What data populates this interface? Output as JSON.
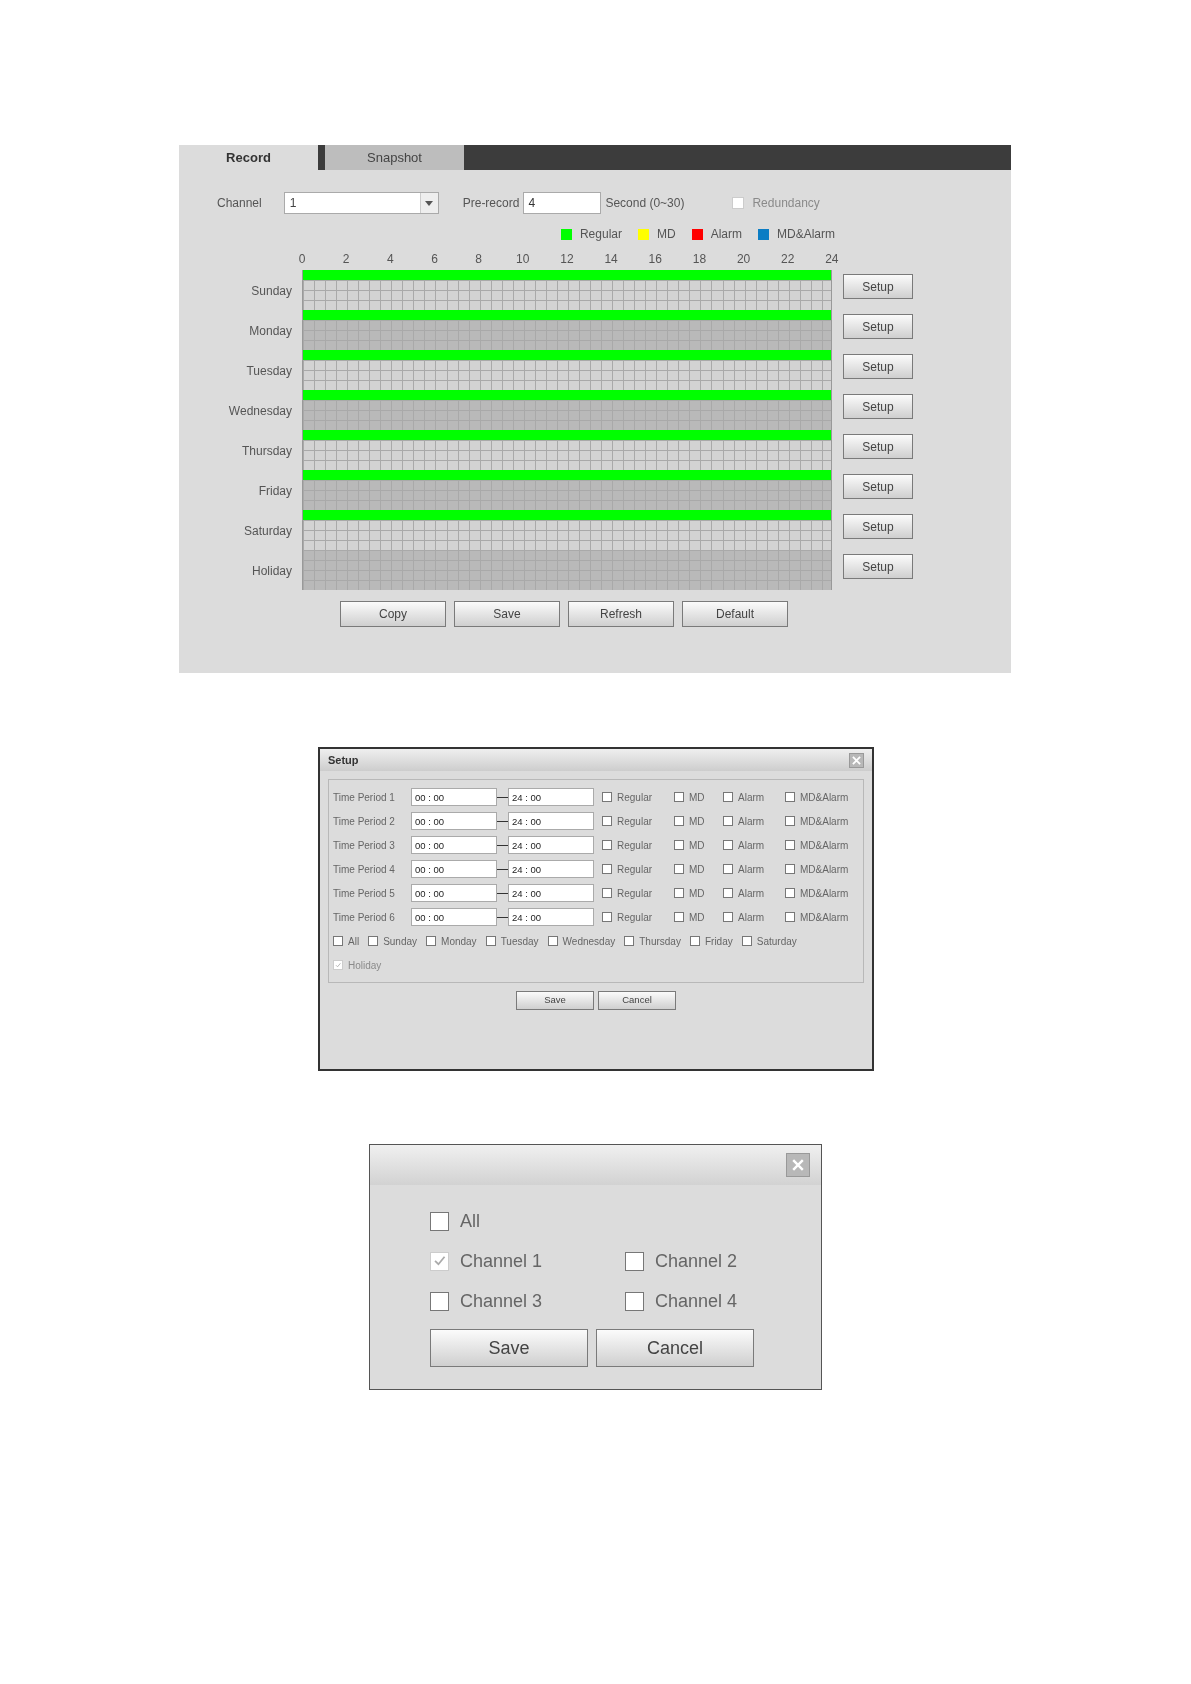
{
  "record_panel": {
    "tabs": [
      {
        "label": "Record",
        "selected": true
      },
      {
        "label": "Snapshot",
        "selected": false
      }
    ],
    "channel": {
      "label": "Channel",
      "value": "1"
    },
    "pre_record": {
      "label": "Pre-record",
      "value": "4",
      "unit": "Second (0~30)"
    },
    "redundancy": {
      "label": "Redundancy",
      "checked": false,
      "disabled": true
    },
    "legend": [
      {
        "label": "Regular",
        "color": "#00ff00"
      },
      {
        "label": "MD",
        "color": "#ffff00"
      },
      {
        "label": "Alarm",
        "color": "#ff0000"
      },
      {
        "label": "MD&Alarm",
        "color": "#0b7dc4"
      }
    ],
    "hours": [
      "0",
      "2",
      "4",
      "6",
      "8",
      "10",
      "12",
      "14",
      "16",
      "18",
      "20",
      "22",
      "24"
    ],
    "days": [
      {
        "name": "Sunday",
        "color": "#00ff00",
        "level": 1,
        "setup": "Setup"
      },
      {
        "name": "Monday",
        "color": "#00ff00",
        "level": 1,
        "setup": "Setup"
      },
      {
        "name": "Tuesday",
        "color": "#00ff00",
        "level": 1,
        "setup": "Setup"
      },
      {
        "name": "Wednesday",
        "color": "#00ff00",
        "level": 1,
        "setup": "Setup"
      },
      {
        "name": "Thursday",
        "color": "#00ff00",
        "level": 1,
        "setup": "Setup"
      },
      {
        "name": "Friday",
        "color": "#00ff00",
        "level": 1,
        "setup": "Setup"
      },
      {
        "name": "Saturday",
        "color": "#00ff00",
        "level": 1,
        "setup": "Setup"
      },
      {
        "name": "Holiday",
        "setup": "Setup"
      }
    ],
    "buttons": [
      "Copy",
      "Save",
      "Refresh",
      "Default"
    ]
  },
  "setup_dialog": {
    "title": "Setup",
    "periods": [
      {
        "label": "Time Period 1",
        "start": "00 : 00",
        "end": "24 : 00",
        "types": [
          {
            "label": "Regular",
            "checked": false
          },
          {
            "label": "MD",
            "checked": false
          },
          {
            "label": "Alarm",
            "checked": false
          },
          {
            "label": "MD&Alarm",
            "checked": false
          }
        ]
      },
      {
        "label": "Time Period 2",
        "start": "00 : 00",
        "end": "24 : 00",
        "types": [
          {
            "label": "Regular",
            "checked": false
          },
          {
            "label": "MD",
            "checked": false
          },
          {
            "label": "Alarm",
            "checked": false
          },
          {
            "label": "MD&Alarm",
            "checked": false
          }
        ]
      },
      {
        "label": "Time Period 3",
        "start": "00 : 00",
        "end": "24 : 00",
        "types": [
          {
            "label": "Regular",
            "checked": false
          },
          {
            "label": "MD",
            "checked": false
          },
          {
            "label": "Alarm",
            "checked": false
          },
          {
            "label": "MD&Alarm",
            "checked": false
          }
        ]
      },
      {
        "label": "Time Period 4",
        "start": "00 : 00",
        "end": "24 : 00",
        "types": [
          {
            "label": "Regular",
            "checked": false
          },
          {
            "label": "MD",
            "checked": false
          },
          {
            "label": "Alarm",
            "checked": false
          },
          {
            "label": "MD&Alarm",
            "checked": false
          }
        ]
      },
      {
        "label": "Time Period 5",
        "start": "00 : 00",
        "end": "24 : 00",
        "types": [
          {
            "label": "Regular",
            "checked": false
          },
          {
            "label": "MD",
            "checked": false
          },
          {
            "label": "Alarm",
            "checked": false
          },
          {
            "label": "MD&Alarm",
            "checked": false
          }
        ]
      },
      {
        "label": "Time Period 6",
        "start": "00 : 00",
        "end": "24 : 00",
        "types": [
          {
            "label": "Regular",
            "checked": false
          },
          {
            "label": "MD",
            "checked": false
          },
          {
            "label": "Alarm",
            "checked": false
          },
          {
            "label": "MD&Alarm",
            "checked": false
          }
        ]
      }
    ],
    "day_rows": [
      [
        {
          "label": "All",
          "checked": false,
          "disabled": false
        },
        {
          "label": "Sunday",
          "checked": false,
          "disabled": false
        },
        {
          "label": "Monday",
          "checked": false,
          "disabled": false
        },
        {
          "label": "Tuesday",
          "checked": false,
          "disabled": false
        },
        {
          "label": "Wednesday",
          "checked": false,
          "disabled": false
        },
        {
          "label": "Thursday",
          "checked": false,
          "disabled": false
        },
        {
          "label": "Friday",
          "checked": false,
          "disabled": false
        },
        {
          "label": "Saturday",
          "checked": false,
          "disabled": false
        }
      ],
      [
        {
          "label": "Holiday",
          "checked": true,
          "disabled": true
        }
      ]
    ],
    "buttons": [
      "Save",
      "Cancel"
    ]
  },
  "channel_dialog": {
    "option_rows": [
      [
        {
          "label": "All",
          "checked": false,
          "disabled": false
        }
      ],
      [
        {
          "label": "Channel 1",
          "checked": true,
          "disabled": true
        },
        {
          "label": "Channel 2",
          "checked": false,
          "disabled": false
        }
      ],
      [
        {
          "label": "Channel 3",
          "checked": false,
          "disabled": false
        },
        {
          "label": "Channel 4",
          "checked": false,
          "disabled": false
        }
      ]
    ],
    "buttons": [
      "Save",
      "Cancel"
    ]
  }
}
